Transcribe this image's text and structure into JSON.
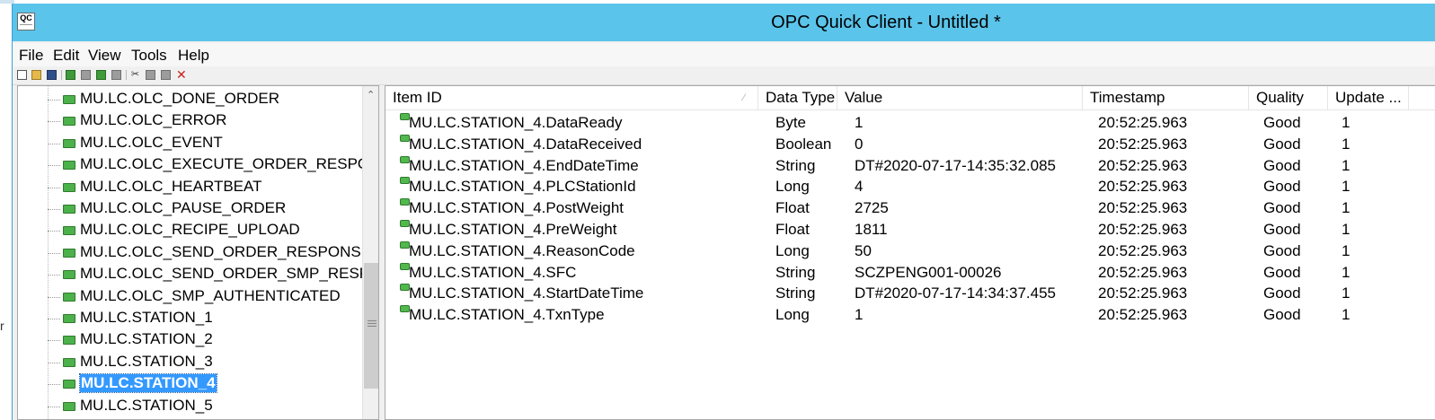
{
  "window": {
    "title": "OPC Quick Client - Untitled *",
    "icon_label": "QC"
  },
  "background_fragment": "r",
  "menu": [
    "File",
    "Edit",
    "View",
    "Tools",
    "Help"
  ],
  "toolbar": [
    {
      "icon": "new-document-icon"
    },
    {
      "icon": "open-folder-icon"
    },
    {
      "icon": "save-icon"
    },
    {
      "icon": "new-server-connection-icon"
    },
    {
      "icon": "new-group-icon"
    },
    {
      "icon": "new-item-icon"
    },
    {
      "icon": "properties-icon"
    },
    {
      "icon": "cut-icon"
    },
    {
      "icon": "copy-icon"
    },
    {
      "icon": "paste-icon"
    },
    {
      "icon": "delete-icon"
    }
  ],
  "tree": {
    "items": [
      {
        "label": "MU.LC.OLC_DONE_ORDER",
        "selected": false
      },
      {
        "label": "MU.LC.OLC_ERROR",
        "selected": false
      },
      {
        "label": "MU.LC.OLC_EVENT",
        "selected": false
      },
      {
        "label": "MU.LC.OLC_EXECUTE_ORDER_RESPONSE",
        "selected": false
      },
      {
        "label": "MU.LC.OLC_HEARTBEAT",
        "selected": false
      },
      {
        "label": "MU.LC.OLC_PAUSE_ORDER",
        "selected": false
      },
      {
        "label": "MU.LC.OLC_RECIPE_UPLOAD",
        "selected": false
      },
      {
        "label": "MU.LC.OLC_SEND_ORDER_RESPONSE",
        "selected": false
      },
      {
        "label": "MU.LC.OLC_SEND_ORDER_SMP_RESPON",
        "selected": false
      },
      {
        "label": "MU.LC.OLC_SMP_AUTHENTICATED",
        "selected": false
      },
      {
        "label": "MU.LC.STATION_1",
        "selected": false
      },
      {
        "label": "MU.LC.STATION_2",
        "selected": false
      },
      {
        "label": "MU.LC.STATION_3",
        "selected": false
      },
      {
        "label": "MU.LC.STATION_4",
        "selected": true
      },
      {
        "label": "MU.LC.STATION_5",
        "selected": false
      }
    ]
  },
  "list": {
    "columns": [
      "Item ID",
      "Data Type",
      "Value",
      "Timestamp",
      "Quality",
      "Update ..."
    ],
    "rows": [
      [
        "MU.LC.STATION_4.DataReady",
        "Byte",
        "1",
        "20:52:25.963",
        "Good",
        "1"
      ],
      [
        "MU.LC.STATION_4.DataReceived",
        "Boolean",
        "0",
        "20:52:25.963",
        "Good",
        "1"
      ],
      [
        "MU.LC.STATION_4.EndDateTime",
        "String",
        "DT#2020-07-17-14:35:32.085",
        "20:52:25.963",
        "Good",
        "1"
      ],
      [
        "MU.LC.STATION_4.PLCStationId",
        "Long",
        "4",
        "20:52:25.963",
        "Good",
        "1"
      ],
      [
        "MU.LC.STATION_4.PostWeight",
        "Float",
        "2725",
        "20:52:25.963",
        "Good",
        "1"
      ],
      [
        "MU.LC.STATION_4.PreWeight",
        "Float",
        "1811",
        "20:52:25.963",
        "Good",
        "1"
      ],
      [
        "MU.LC.STATION_4.ReasonCode",
        "Long",
        "50",
        "20:52:25.963",
        "Good",
        "1"
      ],
      [
        "MU.LC.STATION_4.SFC",
        "String",
        "SCZPENG001-00026",
        "20:52:25.963",
        "Good",
        "1"
      ],
      [
        "MU.LC.STATION_4.StartDateTime",
        "String",
        "DT#2020-07-17-14:34:37.455",
        "20:52:25.963",
        "Good",
        "1"
      ],
      [
        "MU.LC.STATION_4.TxnType",
        "Long",
        "1",
        "20:52:25.963",
        "Good",
        "1"
      ]
    ]
  }
}
